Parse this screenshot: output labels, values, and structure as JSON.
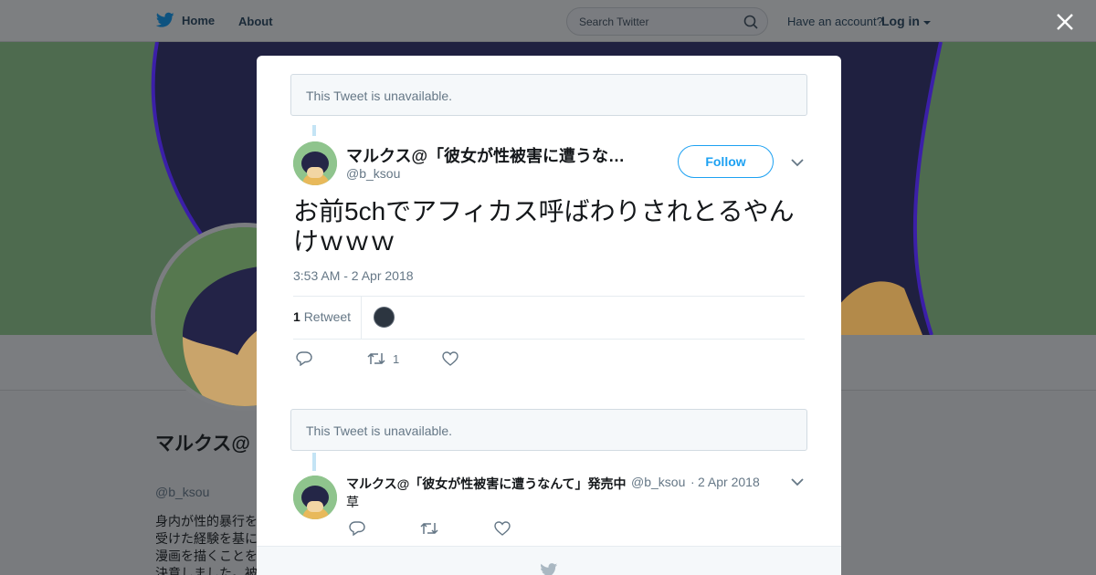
{
  "topbar": {
    "home_label": "Home",
    "about_label": "About",
    "search_placeholder": "Search Twitter",
    "have_account": "Have an account?",
    "login_label": "Log in"
  },
  "profile": {
    "name": "マルクス@「彼女が性被害に遭うなんて」発売中",
    "handle": "@b_ksou",
    "bio": "身内が性的暴行を受けた経験を基に漫画を描くことを決意しました。被害者の心に残る日常的な男性のテーマに漫画を描"
  },
  "modal": {
    "unavailable_text_1": "This Tweet is unavailable.",
    "tweet": {
      "name": "マルクス@「彼女が性被害に遭うな…",
      "handle": "@b_ksou",
      "follow_label": "Follow",
      "text": "お前5chでアフィカス呼ばわりされとるやんけｗｗｗ",
      "timestamp": "3:53 AM - 2 Apr 2018",
      "retweet_count": "1",
      "retweet_label": "Retweet",
      "action_retweet_count": "1"
    },
    "unavailable_text_2": "This Tweet is unavailable.",
    "reply": {
      "name": "マルクス@「彼女が性被害に遭うなんて」発売中",
      "handle": "@b_ksou",
      "separator": "·",
      "date": "2 Apr 2018",
      "text": "草"
    }
  },
  "colors": {
    "accent": "#1da1f2",
    "thread_line": "#c4e4f5",
    "muted_text": "#657786",
    "banner_green": "#4e6b4f"
  }
}
